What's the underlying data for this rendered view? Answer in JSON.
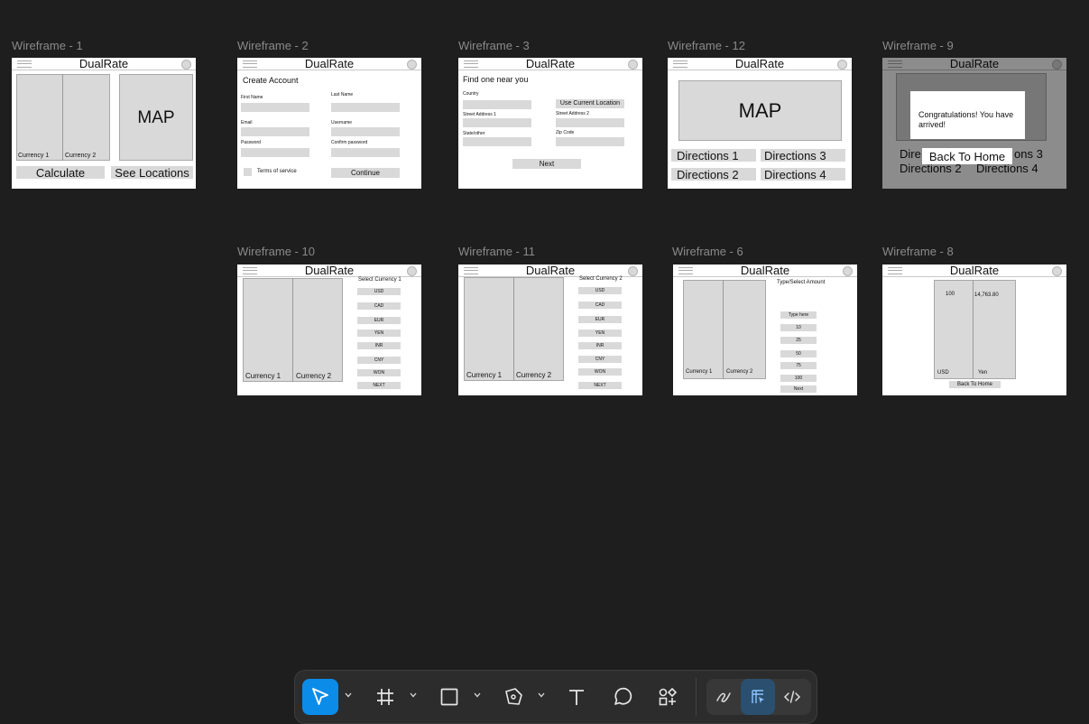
{
  "frames": {
    "f1": {
      "label": "Wireframe - 1",
      "app": "DualRate",
      "currency1": "Currency 1",
      "currency2": "Currency 2",
      "map": "MAP",
      "calculate": "Calculate",
      "see_locations": "See Locations"
    },
    "f2": {
      "label": "Wireframe - 2",
      "app": "DualRate",
      "heading": "Create Account",
      "first_name": "First Name",
      "last_name": "Last Name",
      "email": "Email",
      "username": "Username",
      "password": "Password",
      "confirm_password": "Confirm password",
      "terms": "Terms of service",
      "continue": "Continue"
    },
    "f3": {
      "label": "Wireframe - 3",
      "app": "DualRate",
      "heading": "Find one near you",
      "country": "Country",
      "use_location": "Use Current Location",
      "street1": "Street Address 1",
      "street2": "Street Address 2",
      "state": "State/other",
      "zip": "Zip Code",
      "next": "Next"
    },
    "f12": {
      "label": "Wireframe - 12",
      "app": "DualRate",
      "map": "MAP",
      "d1": "Directions 1",
      "d2": "Directions 2",
      "d3": "Directions 3",
      "d4": "Directions 4"
    },
    "f9": {
      "label": "Wireframe - 9",
      "app": "DualRate",
      "congrats": "Congratulations! You have arrived!",
      "d1_partial": "Dire",
      "d3_partial": "ons 3",
      "d2": "Directions 2",
      "d4": "Directions 4",
      "back_home": "Back To Home"
    },
    "f10": {
      "label": "Wireframe - 10",
      "app": "DualRate",
      "select": "Select Currency 1",
      "currency1": "Currency 1",
      "currency2": "Currency 2",
      "options": [
        "USD",
        "CAD",
        "EUR",
        "YEN",
        "INR",
        "CNY",
        "WON",
        "NEXT"
      ]
    },
    "f11": {
      "label": "Wireframe - 11",
      "app": "DualRate",
      "select": "Select Currency 2",
      "currency1": "Currency 1",
      "currency2": "Currency 2",
      "options": [
        "USD",
        "CAD",
        "EUR",
        "YEN",
        "INR",
        "CNY",
        "WON",
        "NEXT"
      ]
    },
    "f6": {
      "label": "Wireframe - 6",
      "app": "DualRate",
      "prompt": "Type/Select Amount",
      "currency1": "Currency 1",
      "currency2": "Currency 2",
      "options": [
        "Type here",
        "10",
        "25",
        "50",
        "75",
        "100",
        "Next"
      ]
    },
    "f8": {
      "label": "Wireframe - 8",
      "app": "DualRate",
      "amount": "100",
      "result": "14,763.80",
      "from": "USD",
      "to": "Yen",
      "back_home": "Back To Home"
    }
  },
  "toolbar": {
    "tools": [
      "move-tool",
      "frame-tool",
      "shape-tool",
      "pen-tool",
      "text-tool",
      "comment-tool",
      "actions-tool"
    ],
    "modes": [
      "draw-mode",
      "design-mode",
      "dev-mode"
    ],
    "accent": "#0c8ce9"
  }
}
